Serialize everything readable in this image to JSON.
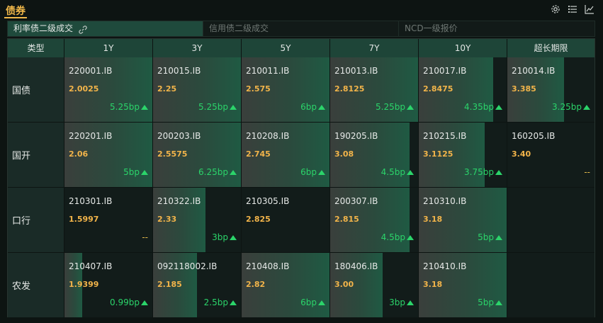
{
  "header": {
    "title": "债券"
  },
  "icons": [
    "gear-icon",
    "list-icon",
    "line-chart-icon"
  ],
  "tabs": [
    {
      "label": "利率债二级成交",
      "active": true
    },
    {
      "label": "信用债二级成交",
      "active": false
    },
    {
      "label": "NCD一级报价",
      "active": false
    }
  ],
  "columns": [
    "类型",
    "1Y",
    "3Y",
    "5Y",
    "7Y",
    "10Y",
    "超长期限"
  ],
  "rows": [
    {
      "type": "国债",
      "cells": [
        {
          "code": "220001.IB",
          "yield": "2.0025",
          "change": "5.25bp",
          "up": true,
          "level": 1.0
        },
        {
          "code": "210015.IB",
          "yield": "2.25",
          "change": "5.25bp",
          "up": true,
          "level": 1.0
        },
        {
          "code": "210011.IB",
          "yield": "2.575",
          "change": "6bp",
          "up": true,
          "level": 1.0
        },
        {
          "code": "210013.IB",
          "yield": "2.8125",
          "change": "5.25bp",
          "up": true,
          "level": 1.0
        },
        {
          "code": "210017.IB",
          "yield": "2.8475",
          "change": "4.35bp",
          "up": true,
          "level": 0.85
        },
        {
          "code": "210014.IB",
          "yield": "3.385",
          "change": "3.25bp",
          "up": true,
          "level": 0.65
        }
      ]
    },
    {
      "type": "国开",
      "cells": [
        {
          "code": "220201.IB",
          "yield": "2.06",
          "change": "5bp",
          "up": true,
          "level": 1.0
        },
        {
          "code": "200203.IB",
          "yield": "2.5575",
          "change": "6.25bp",
          "up": true,
          "level": 1.0
        },
        {
          "code": "210208.IB",
          "yield": "2.745",
          "change": "6bp",
          "up": true,
          "level": 1.0
        },
        {
          "code": "190205.IB",
          "yield": "3.08",
          "change": "4.5bp",
          "up": true,
          "level": 0.9
        },
        {
          "code": "210215.IB",
          "yield": "3.1125",
          "change": "3.75bp",
          "up": true,
          "level": 0.75
        },
        {
          "code": "160205.IB",
          "yield": "3.40",
          "change": "--",
          "up": false,
          "level": 0
        }
      ]
    },
    {
      "type": "口行",
      "cells": [
        {
          "code": "210301.IB",
          "yield": "1.5997",
          "change": "--",
          "up": false,
          "level": 0
        },
        {
          "code": "210322.IB",
          "yield": "2.33",
          "change": "3bp",
          "up": true,
          "level": 0.6
        },
        {
          "code": "210305.IB",
          "yield": "2.825",
          "change": "",
          "up": false,
          "level": 0
        },
        {
          "code": "200307.IB",
          "yield": "2.815",
          "change": "4.5bp",
          "up": true,
          "level": 0.9
        },
        {
          "code": "210310.IB",
          "yield": "3.18",
          "change": "5bp",
          "up": true,
          "level": 1.0
        },
        {
          "code": "",
          "yield": "",
          "change": "",
          "up": false,
          "level": 0
        }
      ]
    },
    {
      "type": "农发",
      "cells": [
        {
          "code": "210407.IB",
          "yield": "1.9399",
          "change": "0.99bp",
          "up": true,
          "level": 0.2
        },
        {
          "code": "092118002.IB",
          "yield": "2.185",
          "change": "2.5bp",
          "up": true,
          "level": 0.5
        },
        {
          "code": "210408.IB",
          "yield": "2.82",
          "change": "6bp",
          "up": true,
          "level": 1.0
        },
        {
          "code": "180406.IB",
          "yield": "3.00",
          "change": "3bp",
          "up": true,
          "level": 0.6
        },
        {
          "code": "210410.IB",
          "yield": "3.18",
          "change": "5bp",
          "up": true,
          "level": 1.0
        },
        {
          "code": "",
          "yield": "",
          "change": "",
          "up": false,
          "level": 0
        }
      ]
    }
  ]
}
